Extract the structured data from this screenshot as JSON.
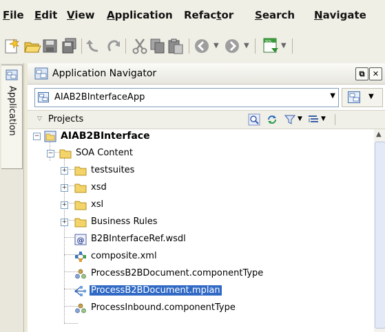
{
  "menu": {
    "items": [
      {
        "label": "File",
        "mnemonic_index": 0
      },
      {
        "label": "Edit",
        "mnemonic_index": 0
      },
      {
        "label": "View",
        "mnemonic_index": 0
      },
      {
        "label": "Application",
        "mnemonic_index": 0
      },
      {
        "label": "Refactor",
        "mnemonic_index": 5
      },
      {
        "label": "Search",
        "mnemonic_index": 0
      },
      {
        "label": "Navigate",
        "mnemonic_index": 0
      }
    ]
  },
  "toolbar": {
    "icons": [
      "new-gallery-icon",
      "open-icon",
      "save-icon",
      "save-all-icon",
      "undo-icon",
      "redo-icon",
      "cut-icon",
      "copy-icon",
      "paste-icon",
      "back-icon",
      "forward-icon",
      "sql-worksheet-icon"
    ]
  },
  "side_tab": {
    "label": "Application"
  },
  "navigator": {
    "title": "Application Navigator",
    "app_name": "AIAB2BInterfaceApp",
    "projects_label": "Projects"
  },
  "tree": [
    {
      "label": "AIAB2BInterface",
      "level": 0,
      "expander": "-",
      "icon": "project-icon",
      "bold": true
    },
    {
      "label": "SOA Content",
      "level": 1,
      "expander": "-",
      "icon": "folder-icon"
    },
    {
      "label": "testsuites",
      "level": 2,
      "expander": "+",
      "icon": "folder-icon"
    },
    {
      "label": "xsd",
      "level": 2,
      "expander": "+",
      "icon": "folder-icon"
    },
    {
      "label": "xsl",
      "level": 2,
      "expander": "+",
      "icon": "folder-icon"
    },
    {
      "label": "Business Rules",
      "level": 2,
      "expander": "+",
      "icon": "folder-icon"
    },
    {
      "label": "B2BInterfaceRef.wsdl",
      "level": 2,
      "icon": "wsdl-icon"
    },
    {
      "label": "composite.xml",
      "level": 2,
      "icon": "composite-icon"
    },
    {
      "label": "ProcessB2BDocument.componentType",
      "level": 2,
      "icon": "component-type-icon"
    },
    {
      "label": "ProcessB2BDocument.mplan",
      "level": 2,
      "icon": "mplan-icon",
      "selected": true
    },
    {
      "label": "ProcessInbound.componentType",
      "level": 2,
      "icon": "component-type-icon"
    }
  ],
  "colors": {
    "selection": "#316ac5",
    "folder": "#f2d46a"
  }
}
